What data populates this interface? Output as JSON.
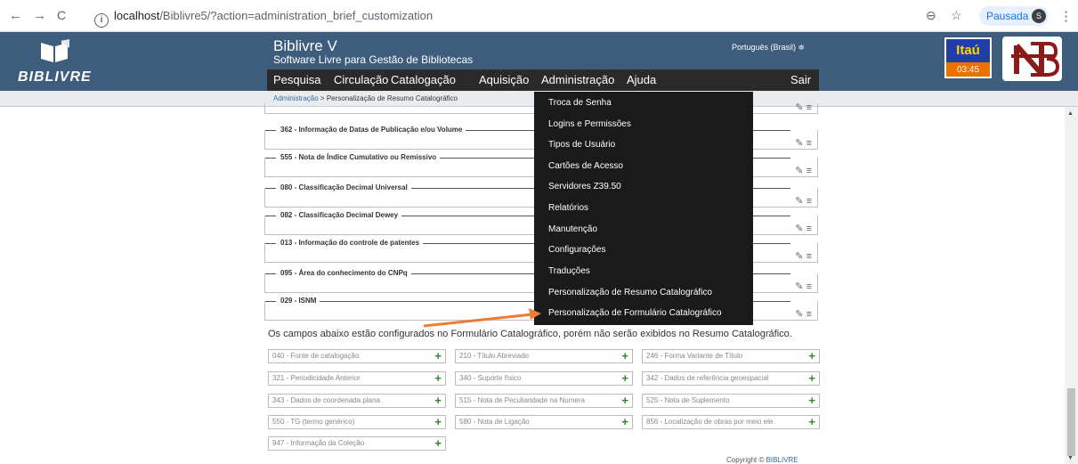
{
  "browser": {
    "back": "←",
    "forward": "→",
    "reload": "C",
    "url_host": "localhost",
    "url_path": "/Biblivre5/?action=administration_brief_customization",
    "zoom_icon": "⊖",
    "star_icon": "☆",
    "paused_label": "Pausada",
    "avatar_letter": "S",
    "menu_icon": "⋮"
  },
  "header": {
    "logo_text": "BIBLIVRE",
    "title": "Biblivre V",
    "subtitle": "Software Livre para Gestão de Bibliotecas",
    "language": "Português (Brasil) ≑",
    "menu": [
      "Pesquisa",
      "Circulação",
      "Catalogação",
      "Aquisição",
      "Administração",
      "Ajuda"
    ],
    "logout": "Sair",
    "itau_label": "Itaú",
    "itau_time": "03:45"
  },
  "breadcrumb": {
    "link": "Administração",
    "separator": " > ",
    "current": "Personalização de Resumo Catalográfico"
  },
  "fields": [
    "362 - Informação de Datas de Publicação e/ou Volume",
    "555 - Nota de Índice Cumulativo ou Remissivo",
    "080 - Classificação Decimal Universal",
    "082 - Classificação Decimal Dewey",
    "013 - Informação do controle de patentes",
    "095 - Área do conhecimento do CNPq",
    "029 - ISNM"
  ],
  "field_tools": "✎ ≡",
  "note": "Os campos abaixo estão configurados no Formulário Catalográfico, porém não serão exibidos no Resumo Catalográfico.",
  "chips": [
    "040 - Fonte de catalogação",
    "210 - Título Abreviado",
    "246 - Forma Variante de Título",
    "321 - Periodicidade Anterior",
    "340 - Suporte físico",
    "342 - Dados de referência geoespacial",
    "343 - Dados de coordenada plana",
    "515 - Nota de Peculiaridade na Numera",
    "525 - Nota de Suplemento",
    "550 - TG (termo genérico)",
    "580 - Nota de Ligação",
    "856 - Localização de obras por meio ele",
    "947 - Informação da Coleção"
  ],
  "chip_plus": "+",
  "copyright_prefix": "Copyright ©",
  "copyright_brand": "BIBLIVRE",
  "dropdown": [
    "Troca de Senha",
    "Logins e Permissões",
    "Tipos de Usuário",
    "Cartões de Acesso",
    "Servidores Z39.50",
    "Relatórios",
    "Manutenção",
    "Configurações",
    "Traduções",
    "Personalização de Resumo Catalográfico",
    "Personalização de Formulário Catalográfico"
  ],
  "colors": {
    "header_bg": "#3e5d7c",
    "menu_bg": "#2a2a2a",
    "dropdown_bg": "#1a1a1a",
    "arrow": "#ed7d31",
    "plus": "#2a8a2a"
  }
}
